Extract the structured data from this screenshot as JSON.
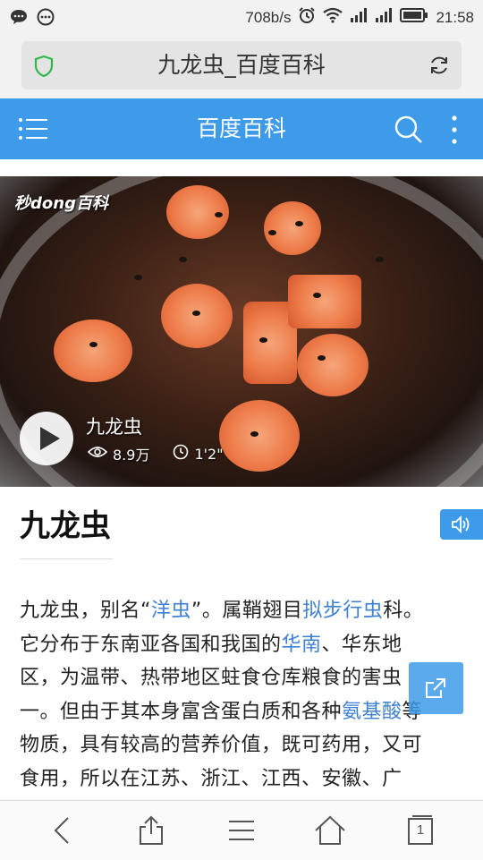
{
  "status_bar": {
    "speed": "708b/s",
    "time": "21:58",
    "icons": [
      "chat-bubble-icon",
      "more-dots-icon",
      "alarm-icon",
      "wifi-icon",
      "signal-icon",
      "signal-icon",
      "battery-icon"
    ]
  },
  "address_bar": {
    "title": "九龙虫_百度百科",
    "icons": [
      "shield-icon",
      "reload-icon"
    ]
  },
  "app_header": {
    "title": "百度百科",
    "icons": [
      "menu-icon",
      "search-icon",
      "more-vertical-icon"
    ]
  },
  "video": {
    "watermark": "秒dong百科",
    "title": "九龙虫",
    "views": "8.9万",
    "duration": "1'2\""
  },
  "article": {
    "title": "九龙虫",
    "p1": "九龙虫，别名“",
    "p1_link1": "洋虫",
    "p1b": "”。属鞘翅目",
    "p1_link2": "拟步行虫",
    "p1c": "科。",
    "p2": "它分布于东南亚各国和我国的",
    "p2_link": "华南",
    "p2b": "、华东地",
    "p3": "区，为温带、热带地区蛀食仓库粮食的害虫",
    "p4": "一。但由于其本身富含蛋白质和各种",
    "p4_link": "氨基酸",
    "p4b": "等",
    "p5": "物质，具有较高的营养价值，既可药用，又可",
    "p6": "食用，所以在江苏、浙江、江西、安徽、广"
  },
  "toolbar": {
    "tab_count": "1",
    "icons": [
      "back-icon",
      "share-icon",
      "menu-lines-icon",
      "home-icon",
      "tabs-icon"
    ]
  },
  "colors": {
    "accent": "#3e9be9",
    "link": "#3e7fd1"
  }
}
